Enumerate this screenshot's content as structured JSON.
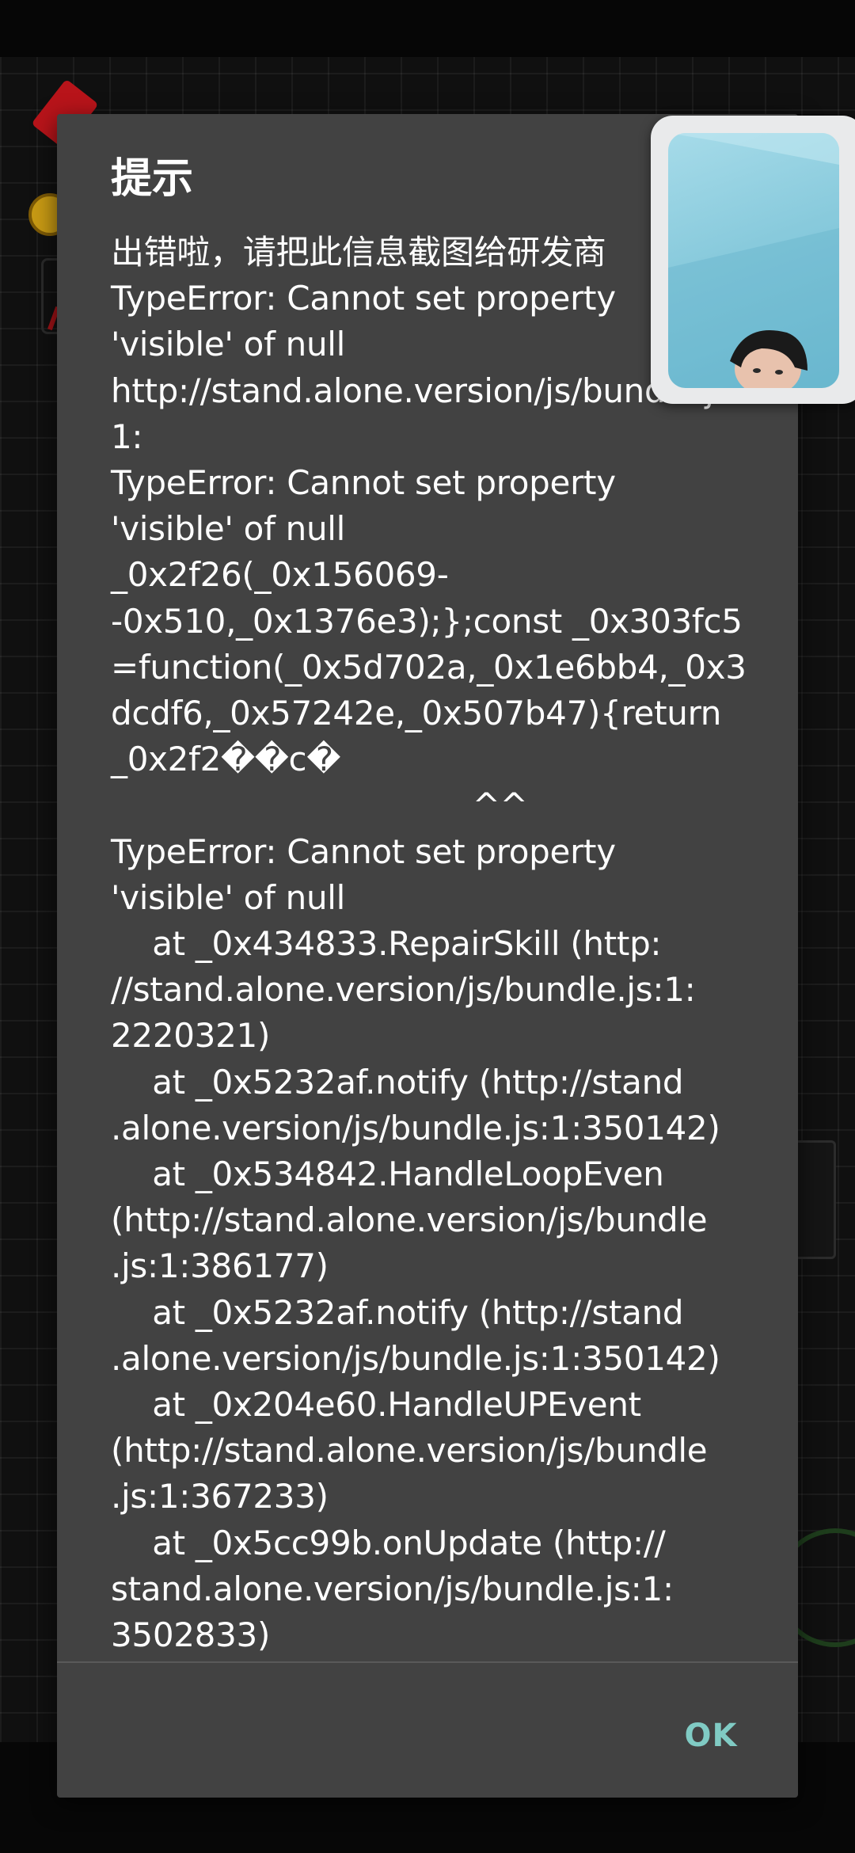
{
  "dialog": {
    "title": "提示",
    "message_lines": [
      "出错啦，请把此信息截图给研发商",
      "TypeError: Cannot set property",
      "'visible' of null",
      "http://stand.alone.version/js/bundle.js:",
      "1:",
      "TypeError: Cannot set property",
      "'visible' of null",
      "_0x2f26(_0x156069-",
      "-0x510,_0x1376e3);};const _0x303fc5",
      "=function(_0x5d702a,_0x1e6bb4,_0x3",
      "dcdf6,_0x57242e,_0x507b47){return",
      "_0x2f2��c�",
      "                                   ^^",
      "TypeError: Cannot set property",
      "'visible' of null",
      "    at _0x434833.RepairSkill (http:",
      "//stand.alone.version/js/bundle.js:1:",
      "2220321)",
      "    at _0x5232af.notify (http://stand",
      ".alone.version/js/bundle.js:1:350142)",
      "    at _0x534842.HandleLoopEven",
      "(http://stand.alone.version/js/bundle",
      ".js:1:386177)",
      "    at _0x5232af.notify (http://stand",
      ".alone.version/js/bundle.js:1:350142)",
      "    at _0x204e60.HandleUPEvent",
      "(http://stand.alone.version/js/bundle",
      ".js:1:367233)",
      "    at _0x5cc99b.onUpdate (http://",
      "stand.alone.version/js/bundle.js:1:",
      "3502833)"
    ],
    "ok_label": "OK",
    "ok_color": "#80cbc4",
    "background_color": "#424242"
  },
  "camera_overlay": {
    "icon": "camera-preview"
  }
}
